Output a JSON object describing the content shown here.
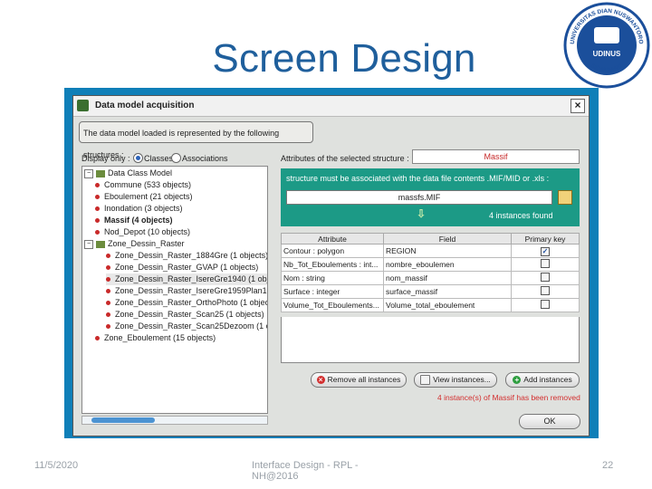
{
  "slide": {
    "title": "Screen Design",
    "footer_date": "11/5/2020",
    "footer_center": "Interface Design - RPL - NH@2016",
    "page_number": "22",
    "logo": {
      "top_text": "UNIVERSITAS DIAN NUSWANTORO",
      "center_text": "UDINUS",
      "bottom_text": "SEMARANG"
    }
  },
  "window": {
    "title": "Data model acquisition",
    "close_symbol": "×",
    "notice": "The data model loaded is represented by the following structures :"
  },
  "display": {
    "label": "Display only :",
    "options": [
      "Classes",
      "Associations"
    ],
    "selected": "Classes"
  },
  "tree": {
    "root": "Data Class Model",
    "items": [
      "Commune (533 objects)",
      "Eboulement (21 objects)",
      "Inondation (3 objects)",
      "Massif (4 objects)",
      "Nod_Depot (10 objects)",
      "Zone_Dessin_Raster",
      "Zone_Dessin_Raster_1884Gre (1 objects)",
      "Zone_Dessin_Raster_GVAP (1 objects)",
      "Zone_Dessin_Raster_IsereGre1940 (1 obje",
      "Zone_Dessin_Raster_IsereGre1959Plan10",
      "Zone_Dessin_Raster_OrthoPhoto (1 objec",
      "Zone_Dessin_Raster_Scan25 (1 objects)",
      "Zone_Dessin_Raster_Scan25Dezoom (1 ob",
      "Zone_Eboulement (15 objects)"
    ]
  },
  "attributes": {
    "label": "Attributes of the selected structure :",
    "selected_structure": "Massif",
    "association_msg": "structure must be associated with the data file contents .MIF/MID or .xls :",
    "file": "massfs.MIF",
    "arrow": "⇩",
    "instances_found": "4 instances found",
    "columns": [
      "Attribute",
      "Field",
      "Primary key"
    ],
    "rows": [
      {
        "attribute": "Contour : polygon",
        "field": "REGION",
        "pk": "✓"
      },
      {
        "attribute": "Nb_Tot_Eboulements : int...",
        "field": "nombre_eboulemen",
        "pk": ""
      },
      {
        "attribute": "Nom : string",
        "field": "nom_massif",
        "pk": ""
      },
      {
        "attribute": "Surface : integer",
        "field": "surface_massif",
        "pk": ""
      },
      {
        "attribute": "Volume_Tot_Eboulements...",
        "field": "Volume_total_eboulement",
        "pk": ""
      }
    ]
  },
  "actions": {
    "remove_all": "Remove all instances",
    "view": "View instances...",
    "add": "Add instances",
    "status": "4 instance(s) of Massif has been removed",
    "ok": "OK"
  },
  "colors": {
    "accent": "#1f5f9c",
    "frame": "#0f7fb8",
    "panel": "#1c9a86",
    "error": "#d32f2f"
  }
}
